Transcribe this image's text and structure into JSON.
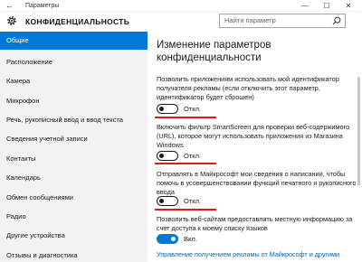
{
  "window": {
    "title": "Параметры",
    "controls": {
      "minimize": "—",
      "maximize": "☐",
      "close": "✕"
    }
  },
  "header": {
    "back_icon": "arrow-left-icon",
    "section_title": "КОНФИДЕНЦИАЛЬНОСТЬ",
    "search_placeholder": "Найти параметр"
  },
  "sidebar": {
    "items": [
      {
        "label": "Общие",
        "active": true
      },
      {
        "label": "Расположение"
      },
      {
        "label": "Камера"
      },
      {
        "label": "Микрофон"
      },
      {
        "label": "Речь, рукописный ввод и ввод текста"
      },
      {
        "label": "Сведения учетной записи"
      },
      {
        "label": "Контакты"
      },
      {
        "label": "Календарь"
      },
      {
        "label": "Обмен сообщениями"
      },
      {
        "label": "Радио"
      },
      {
        "label": "Другие устройства"
      },
      {
        "label": "Отзывы и диагностика"
      }
    ]
  },
  "main": {
    "heading": "Изменение параметров конфиденциальности",
    "options": [
      {
        "text": "Позволить приложениям использовать мой идентификатор получателя рекламы (если отключить этот параметр, идентификатор будет сброшен)",
        "state": "Откл.",
        "on": false
      },
      {
        "text": "Включить фильтр SmartScreen для проверки веб-содержимого (URL), которое могут использовать приложения из Магазина Windows",
        "state": "Откл.",
        "on": false
      },
      {
        "text": "Отправлять в Майкрософт мои сведения о написании, чтобы помочь в усовершенствовании функций печатного и рукописного ввода",
        "state": "Откл.",
        "on": false
      },
      {
        "text": "Позволить веб-сайтам предоставлять местную информацию за счет доступа к моему списку языков",
        "state": "Вкл.",
        "on": true
      }
    ],
    "link": "Управление получением рекламы от Майкрософт и другими"
  },
  "colors": {
    "accent": "#0078d7",
    "highlight": "#e01919",
    "link": "#0063b1"
  }
}
